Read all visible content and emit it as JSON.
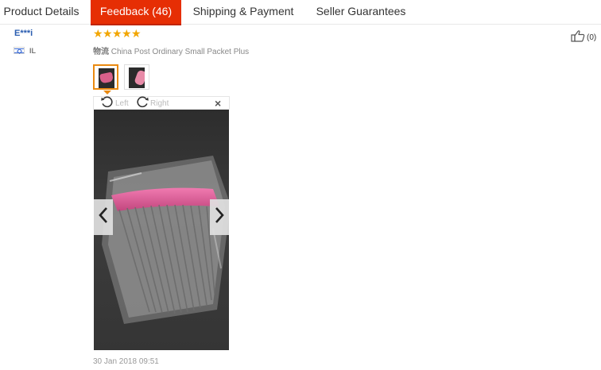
{
  "tabs": [
    {
      "label": "Product Details",
      "active": false
    },
    {
      "label": "Feedback (46)",
      "active": true
    },
    {
      "label": "Shipping & Payment",
      "active": false
    },
    {
      "label": "Seller Guarantees",
      "active": false
    }
  ],
  "review": {
    "reviewer": "E***i",
    "country_code": "IL",
    "rating": 5,
    "logistics_label": "物流",
    "logistics_value": "China Post Ordinary Small Packet Plus",
    "helpful_count": "(0)",
    "date": "30 Jan 2018 09:51"
  },
  "viewer": {
    "rotate_left": "Left",
    "rotate_right": "Right",
    "close": "×",
    "selected_thumb": 1,
    "thumb_count": 2
  },
  "colors": {
    "accent": "#e62e04",
    "star": "#f2a600",
    "selected_thumb_border": "#ea8a11",
    "name": "#2a5db0"
  },
  "icons": [
    "thumbs-up-icon",
    "rotate-left-icon",
    "rotate-right-icon",
    "close-icon",
    "chevron-left-icon",
    "chevron-right-icon",
    "israel-flag-icon",
    "star-icon"
  ]
}
